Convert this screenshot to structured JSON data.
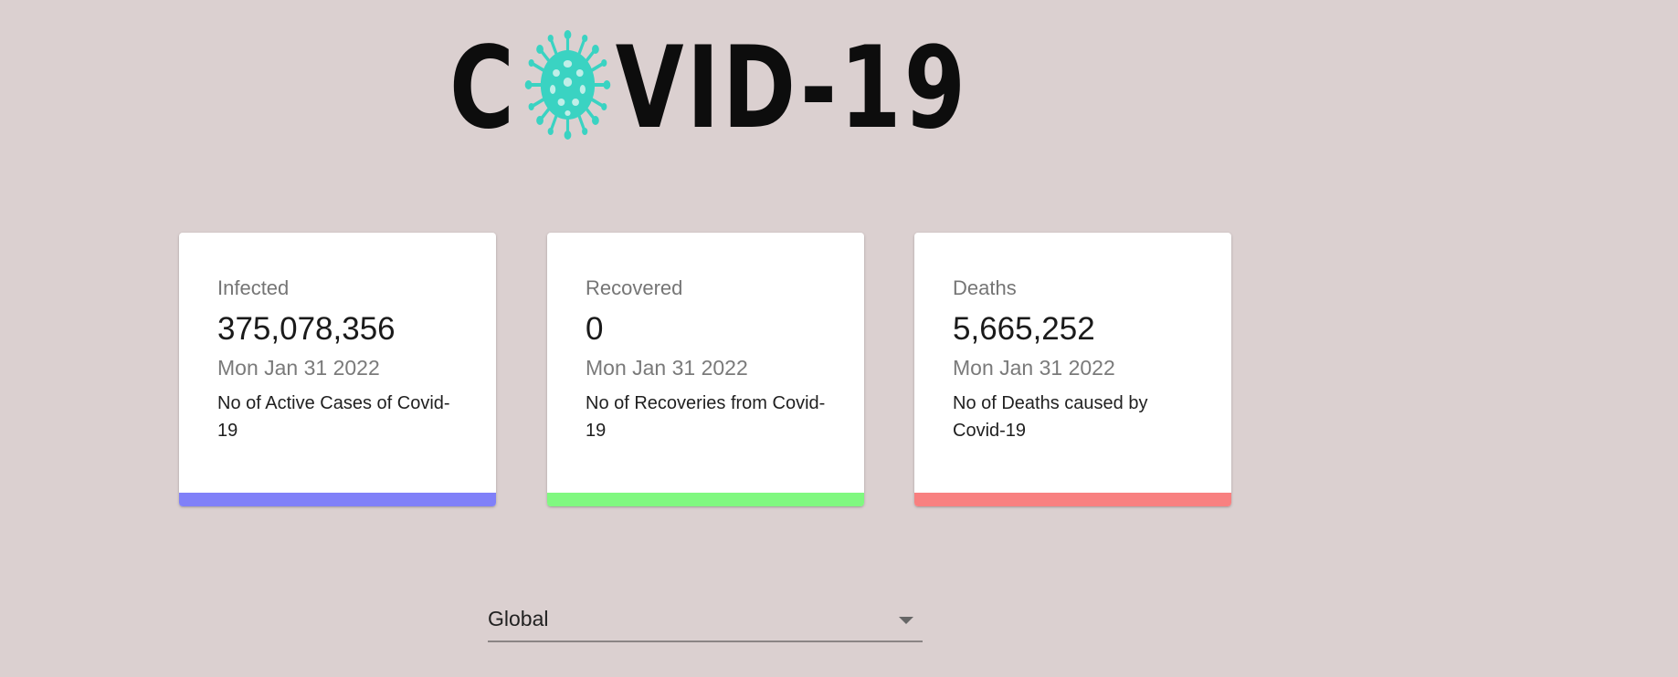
{
  "logo": {
    "text_before": "C",
    "text_after": "VID-19",
    "virus_color": "#3ad3c2",
    "icon": "virus-icon"
  },
  "cards": [
    {
      "title": "Infected",
      "value": "375,078,356",
      "date": "Mon Jan 31 2022",
      "description": "No of Active Cases of Covid-19",
      "accent_color": "#8080f8"
    },
    {
      "title": "Recovered",
      "value": "0",
      "date": "Mon Jan 31 2022",
      "description": "No of Recoveries from Covid-19",
      "accent_color": "#80f880"
    },
    {
      "title": "Deaths",
      "value": "5,665,252",
      "date": "Mon Jan 31 2022",
      "description": "No of Deaths caused by Covid-19",
      "accent_color": "#f88080"
    }
  ],
  "country_select": {
    "value": "Global",
    "icon": "dropdown-arrow-icon"
  }
}
